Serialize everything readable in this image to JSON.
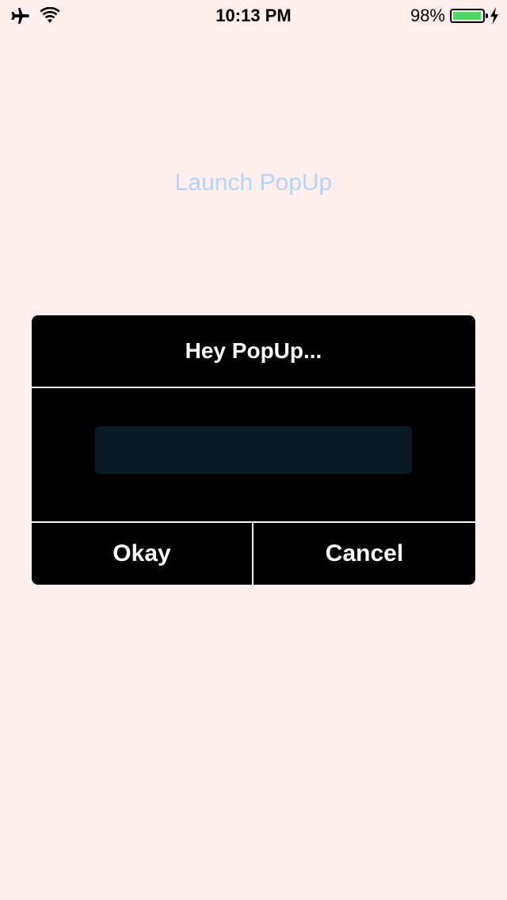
{
  "status_bar": {
    "time": "10:13 PM",
    "battery_percent": "98%",
    "battery_level": 0.98,
    "icons": [
      "airplane-icon",
      "wifi-icon",
      "battery-icon",
      "charging-bolt-icon"
    ],
    "battery_color": "#4cd964"
  },
  "main": {
    "launch_button_label": "Launch PopUp",
    "launch_button_color": "#b4d3f7",
    "background_color": "#feeeed"
  },
  "popup": {
    "title": "Hey PopUp...",
    "input_value": "",
    "input_placeholder": "",
    "okay_label": "Okay",
    "cancel_label": "Cancel",
    "background_color": "#000000",
    "input_color": "#0a1b26"
  }
}
